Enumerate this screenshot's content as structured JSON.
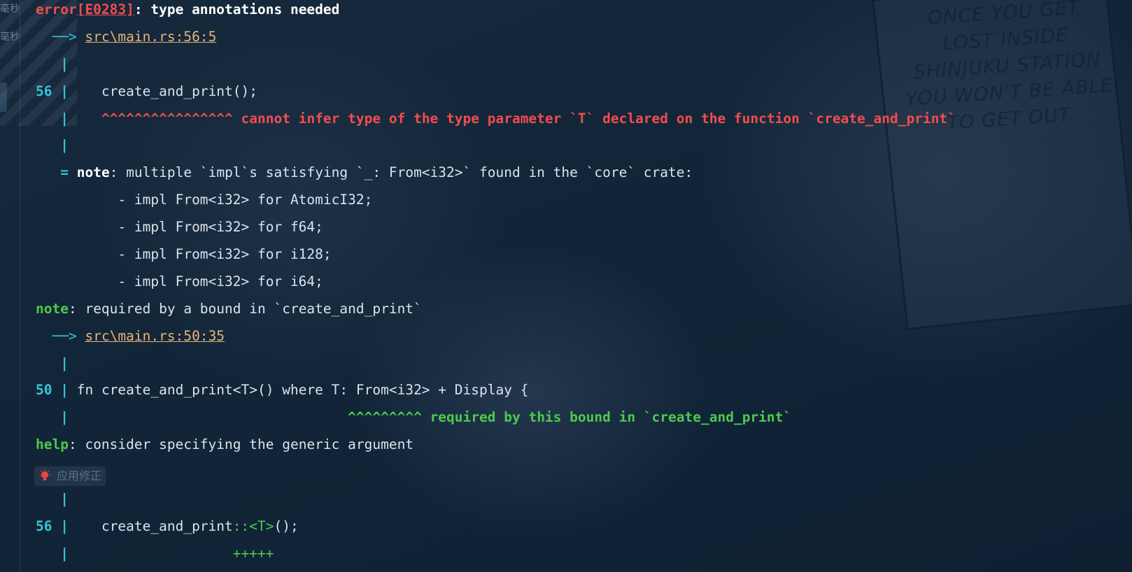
{
  "side": {
    "label_1": "毫秒",
    "label_2": "毫秒"
  },
  "diagnostic": {
    "error_prefix": "error",
    "error_code": "[E0283]",
    "error_message": ": type annotations needed",
    "loc1_arrow": "──>",
    "loc1": "src\\main.rs:56:5",
    "gutter_bar": "|",
    "line56_num": "56",
    "line56_code": "    create_and_print();",
    "underline1": "^^^^^^^^^^^^^^^^",
    "underline1_msg": " cannot infer type of the type parameter `T` declared on the function `create_and_print`",
    "note_eq": "=",
    "note_label": "note",
    "note_msg": ": multiple `impl`s satisfying `_: From<i32>` found in the `core` crate:",
    "impls": [
      "- impl From<i32> for AtomicI32;",
      "- impl From<i32> for f64;",
      "- impl From<i32> for i128;",
      "- impl From<i32> for i64;"
    ],
    "note2_label": "note",
    "note2_msg": ": required by a bound in `create_and_print`",
    "loc2_arrow": "──>",
    "loc2": "src\\main.rs:50:35",
    "line50_num": "50",
    "line50_code": " fn create_and_print<T>() where T: From<i32> + Display {",
    "underline2": "^^^^^^^^^",
    "underline2_msg": " required by this bound in `create_and_print`",
    "help_label": "help",
    "help_msg": ": consider specifying the generic argument",
    "fix_label": "应用修正",
    "line56b_num": "56",
    "line56b_code_pre": "    create_and_print",
    "line56b_code_ins": "::<T>",
    "line56b_code_post": "();",
    "plus_marks": "+++++"
  },
  "background_text": "ONCE YOU GET LOST INSIDE SHINJUKU STATION YOU WON'T BE ABLE TO GET OUT.",
  "colors": {
    "error": "#f24d4d",
    "gutter": "#35c4d8",
    "help": "#4ec94e",
    "link": "#e7b47a",
    "background": "#13263a"
  }
}
